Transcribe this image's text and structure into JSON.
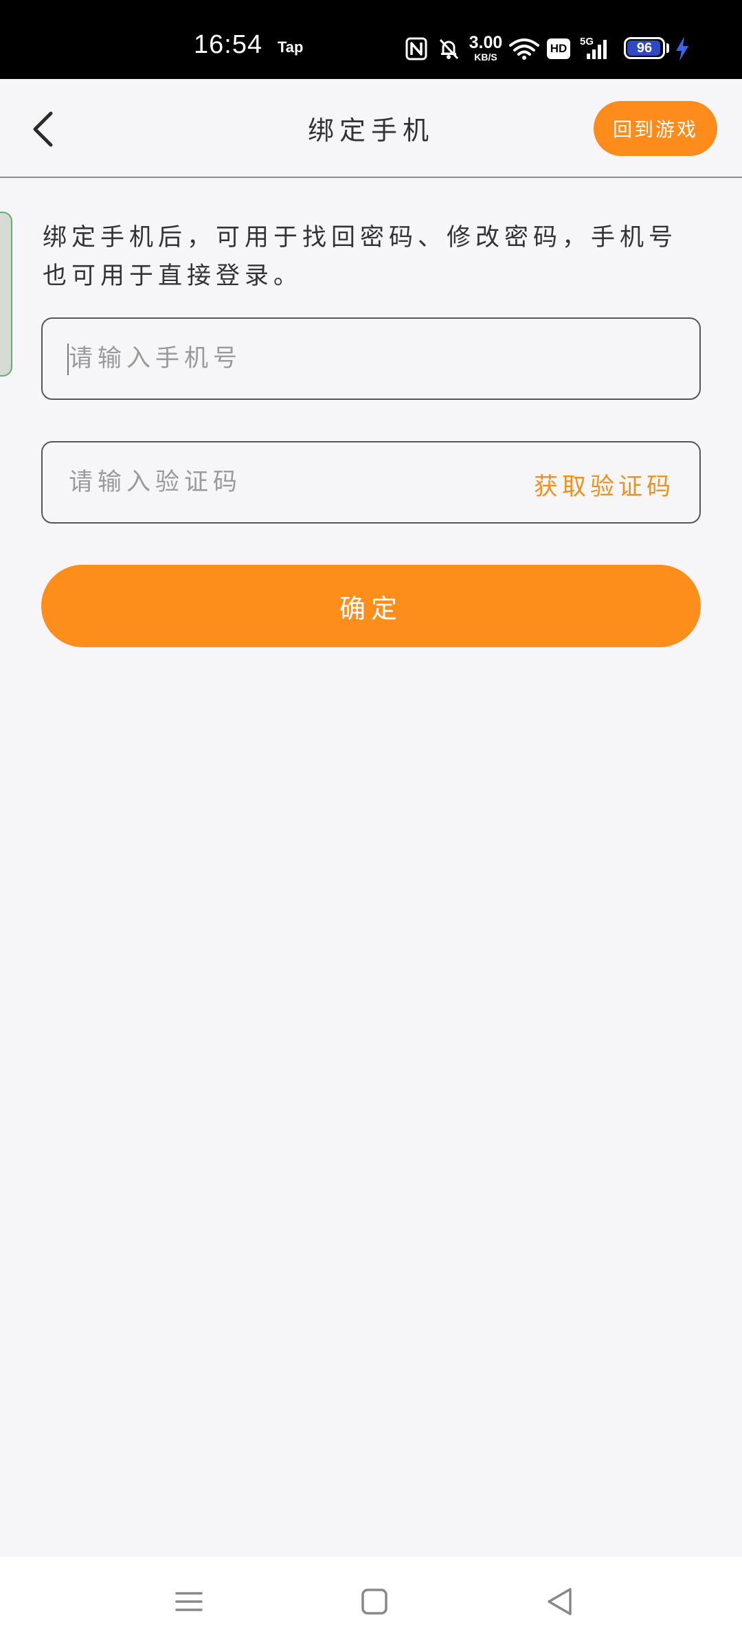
{
  "status_bar": {
    "time": "16:54",
    "app_label": "Tap",
    "net_speed_value": "3.00",
    "net_speed_unit": "KB/S",
    "hd_label": "HD",
    "network_type": "5G",
    "battery_level": "96",
    "battery_fraction": 0.96,
    "icons": [
      "nfc-icon",
      "bell-muted-icon",
      "wifi-icon",
      "signal-icon",
      "charging-icon"
    ]
  },
  "header": {
    "back_icon": "chevron-left-icon",
    "title": "绑定手机",
    "return_game_label": "回到游戏"
  },
  "content": {
    "description": "绑定手机后，可用于找回密码、修改密码，手机号也可用于直接登录。",
    "phone_input": {
      "value": "",
      "placeholder": "请输入手机号"
    },
    "code_input": {
      "value": "",
      "placeholder": "请输入验证码"
    },
    "get_code_label": "获取验证码",
    "confirm_label": "确定"
  },
  "nav_bar": {
    "icons": [
      "menu-icon",
      "home-icon",
      "back-triangle-icon"
    ]
  },
  "colors": {
    "accent": "#fd8c1d",
    "accent_text": "#f0901f",
    "background": "#f6f6f8",
    "status_bar": "#000000",
    "battery_fill": "#2e49c4",
    "side_handle_border": "#5fb070"
  }
}
